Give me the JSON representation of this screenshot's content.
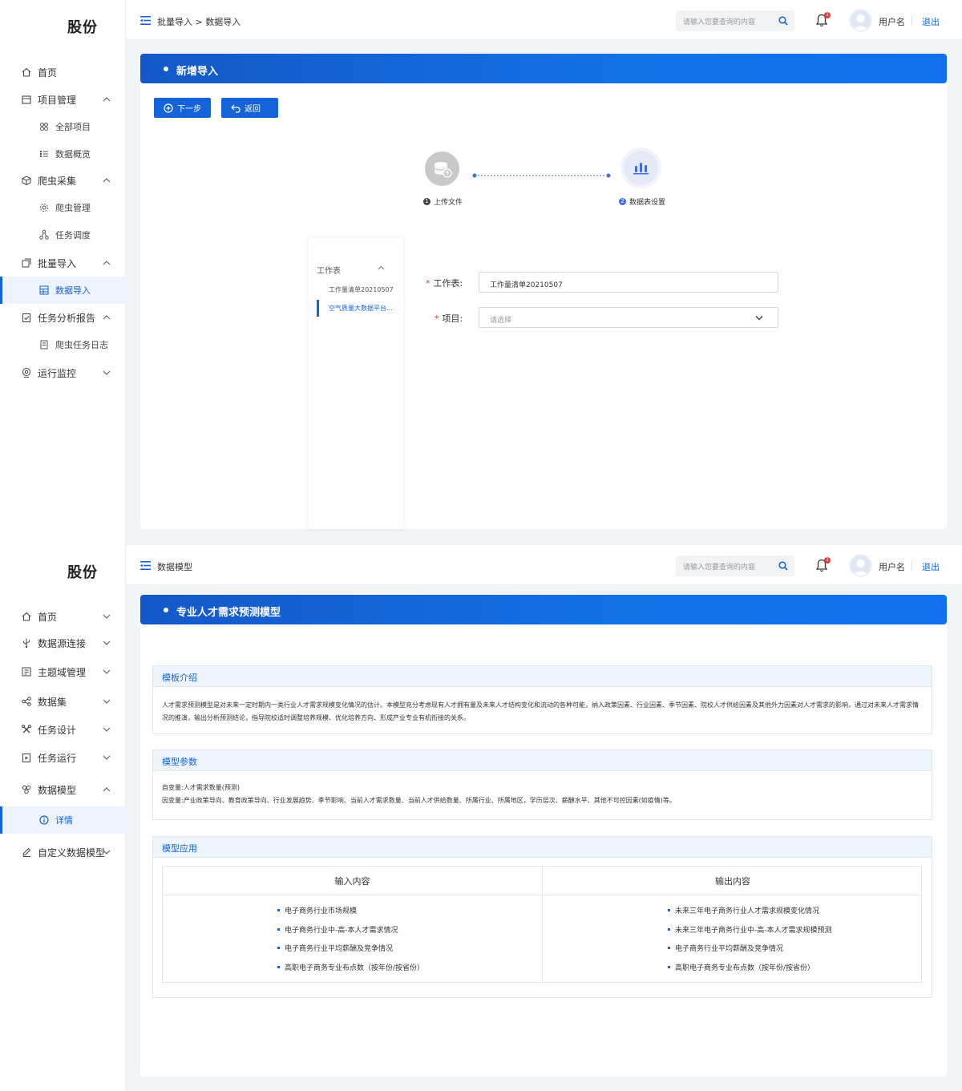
{
  "screen1": {
    "logo": "股份",
    "nav": [
      {
        "label": "首页",
        "icon": "home-icon"
      },
      {
        "label": "项目管理",
        "icon": "folder-icon"
      },
      {
        "label": "全部项目",
        "icon": "grid-icon"
      },
      {
        "label": "数据概览",
        "icon": "list-icon"
      },
      {
        "label": "爬虫采集",
        "icon": "cube-icon"
      },
      {
        "label": "爬虫管理",
        "icon": "gear-icon"
      },
      {
        "label": "任务调度",
        "icon": "nodes-icon"
      },
      {
        "label": "批量导入",
        "icon": "import-icon"
      },
      {
        "label": "数据导入",
        "icon": "table-icon"
      },
      {
        "label": "任务分析报告",
        "icon": "clipboard-icon"
      },
      {
        "label": "爬虫任务日志",
        "icon": "doc-icon"
      },
      {
        "label": "运行监控",
        "icon": "monitor-icon"
      }
    ],
    "breadcrumb": "批量导入 > 数据导入",
    "search_placeholder": "请输入您要查询的内容",
    "notification_count": "1",
    "username": "用户名",
    "logout": "退出",
    "banner_title": "新增导入",
    "btn_next": "下一步",
    "btn_back": "返回",
    "steps": [
      {
        "num": "1",
        "label": "上传文件"
      },
      {
        "num": "2",
        "label": "数据表设置"
      }
    ],
    "sheets_title": "工作表",
    "sheets": [
      "工作量清单20210507",
      "空气质量大数据平台..."
    ],
    "field_sheet_label": "工作表:",
    "field_sheet_value": "工作量清单20210507",
    "field_project_label": "项目:",
    "field_project_placeholder": "请选择",
    "colors": {
      "accent": "#1463d8",
      "danger": "#e53935"
    }
  },
  "screen2": {
    "logo": "股份",
    "nav": [
      {
        "label": "首页",
        "icon": "home-icon"
      },
      {
        "label": "数据源连接",
        "icon": "usb-icon"
      },
      {
        "label": "主题域管理",
        "icon": "list-check-icon"
      },
      {
        "label": "数据集",
        "icon": "share-icon"
      },
      {
        "label": "任务设计",
        "icon": "tools-icon"
      },
      {
        "label": "任务运行",
        "icon": "task-run-icon"
      },
      {
        "label": "数据模型",
        "icon": "model-icon"
      },
      {
        "label": "详情",
        "icon": "info-icon"
      },
      {
        "label": "自定义数据模型",
        "icon": "edit-icon"
      }
    ],
    "breadcrumb": "数据模型",
    "search_placeholder": "请输入您要查询的内容",
    "notification_count": "1",
    "username": "用户名",
    "logout": "退出",
    "banner_title": "专业人才需求预测模型",
    "intro_title": "模板介绍",
    "intro_text": "人才需求预测模型是对未来一定时期内一类行业人才需求规模变化情况的估计。本模型充分考虑现有人才拥有量及未来人才结构变化和流动的各种可能，纳入政策因素、行业因素、季节因素、院校人才供给因素及其他外力因素对人才需求的影响，通过对未来人才需求情况的推演，输出分析预测结论，指导院校适时调整培养规模、优化培养方向、形成产业专业有机衔接的关系。",
    "params_title": "模型参数",
    "params_line1": "自变量:人才需求数量(预测)",
    "params_line2": "因变量:产业政策导向、教育政策导向、行业发展趋势、季节影响、当前人才需求数量、当前人才供给数量、所属行业、所属地区，学历层次、薪酬水平、其他不可控因素(如疫情)等。",
    "apply_title": "模型应用",
    "input_header": "输入内容",
    "output_header": "输出内容",
    "inputs": [
      "电子商务行业市场规模",
      "电子商务行业中-高-本人才需求情况",
      "电子商务行业平均薪酬及竞争情况",
      "高职电子商务专业布点数（按年份/按省份）"
    ],
    "outputs": [
      "未来三年电子商务行业人才需求规模变化情况",
      "未来三年电子商务行业中-高-本人才需求规模预测",
      "电子商务行业平均薪酬及竞争情况",
      "高职电子商务专业布点数（按年份/按省份）"
    ]
  }
}
